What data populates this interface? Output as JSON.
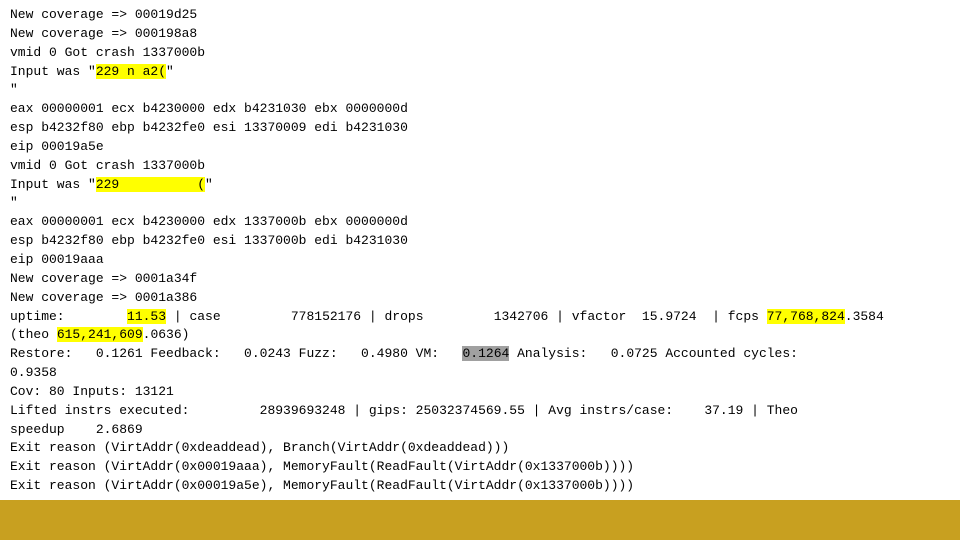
{
  "terminal": {
    "lines": [
      {
        "id": "line1",
        "segments": [
          {
            "text": "New coverage => 00019d25",
            "style": "normal"
          }
        ]
      },
      {
        "id": "line2",
        "segments": [
          {
            "text": "New coverage => 000198a8",
            "style": "normal"
          }
        ]
      },
      {
        "id": "line3",
        "segments": [
          {
            "text": "vmid 0 Got crash 1337000b",
            "style": "normal"
          }
        ]
      },
      {
        "id": "line4",
        "segments": [
          {
            "text": "Input was \"",
            "style": "normal"
          },
          {
            "text": "229 n a2(",
            "style": "highlight-yellow"
          },
          {
            "text": "\"",
            "style": "normal"
          }
        ]
      },
      {
        "id": "line5",
        "segments": [
          {
            "text": "\"",
            "style": "normal"
          }
        ]
      },
      {
        "id": "line6",
        "segments": [
          {
            "text": "eax 00000001 ecx b4230000 edx b4231030 ebx 0000000d",
            "style": "normal"
          }
        ]
      },
      {
        "id": "line7",
        "segments": [
          {
            "text": "esp b4232f80 ebp b4232fe0 esi 13370009 edi b4231030",
            "style": "normal"
          }
        ]
      },
      {
        "id": "line8",
        "segments": [
          {
            "text": "eip 00019a5e",
            "style": "normal"
          }
        ]
      },
      {
        "id": "line9",
        "segments": [
          {
            "text": "vmid 0 Got crash 1337000b",
            "style": "normal"
          }
        ]
      },
      {
        "id": "line10",
        "segments": [
          {
            "text": "Input was \"",
            "style": "normal"
          },
          {
            "text": "229  \t(",
            "style": "highlight-yellow"
          },
          {
            "text": "\"",
            "style": "normal"
          }
        ]
      },
      {
        "id": "line11",
        "segments": [
          {
            "text": "\"",
            "style": "normal"
          }
        ]
      },
      {
        "id": "line12",
        "segments": [
          {
            "text": "",
            "style": "normal"
          }
        ]
      },
      {
        "id": "line13",
        "segments": [
          {
            "text": "eax 00000001 ecx b4230000 edx 1337000b ebx 0000000d",
            "style": "normal"
          }
        ]
      },
      {
        "id": "line14",
        "segments": [
          {
            "text": "esp b4232f80 ebp b4232fe0 esi 1337000b edi b4231030",
            "style": "normal"
          }
        ]
      },
      {
        "id": "line15",
        "segments": [
          {
            "text": "eip 00019aaa",
            "style": "normal"
          }
        ]
      },
      {
        "id": "line16",
        "segments": [
          {
            "text": "New coverage => 0001a34f",
            "style": "normal"
          }
        ]
      },
      {
        "id": "line17",
        "segments": [
          {
            "text": "New coverage => 0001a386",
            "style": "normal"
          }
        ]
      },
      {
        "id": "line18",
        "segments": [
          {
            "text": "uptime:        ",
            "style": "normal"
          },
          {
            "text": "11.53",
            "style": "highlight-yellow"
          },
          {
            "text": " | case         778152176 | drops         1342706 | vfactor  15.9724  | fcps ",
            "style": "normal"
          },
          {
            "text": "77,768,824",
            "style": "highlight-yellow"
          },
          {
            "text": ".3584",
            "style": "normal"
          }
        ]
      },
      {
        "id": "line19",
        "segments": [
          {
            "text": "(theo ",
            "style": "normal"
          },
          {
            "text": "615,241,609",
            "style": "highlight-yellow"
          },
          {
            "text": ".0636)",
            "style": "normal"
          }
        ]
      },
      {
        "id": "line20",
        "segments": [
          {
            "text": "Restore:   0.1261 Feedback:   0.0243 Fuzz:   0.4980 VM:   ",
            "style": "normal"
          },
          {
            "text": "0.1264",
            "style": "highlight-gray"
          },
          {
            "text": " Analysis:   0.0725 Accounted cycles:",
            "style": "normal"
          }
        ]
      },
      {
        "id": "line21",
        "segments": [
          {
            "text": "0.9358",
            "style": "normal"
          }
        ]
      },
      {
        "id": "line22",
        "segments": [
          {
            "text": "Cov: 80 Inputs: 13121",
            "style": "normal"
          }
        ]
      },
      {
        "id": "line23",
        "segments": [
          {
            "text": "Lifted instrs executed:         28939693248 | gips: 25032374569.55 | Avg instrs/case:    37.19 | Theo",
            "style": "normal"
          }
        ]
      },
      {
        "id": "line24",
        "segments": [
          {
            "text": "speedup    2.6869",
            "style": "normal"
          }
        ]
      },
      {
        "id": "line25",
        "segments": [
          {
            "text": "Exit reason (VirtAddr(0xdeaddead), Branch(VirtAddr(0xdeaddead)))",
            "style": "normal"
          }
        ]
      },
      {
        "id": "line26",
        "segments": [
          {
            "text": "Exit reason (VirtAddr(0x00019aaa), MemoryFault(ReadFault(VirtAddr(0x1337000b))))",
            "style": "normal"
          }
        ]
      },
      {
        "id": "line27",
        "segments": [
          {
            "text": "Exit reason (VirtAddr(0x00019a5e), MemoryFault(ReadFault(VirtAddr(0x1337000b))))",
            "style": "normal"
          }
        ]
      }
    ]
  },
  "bottom_bar": {
    "color": "#c8a020"
  }
}
